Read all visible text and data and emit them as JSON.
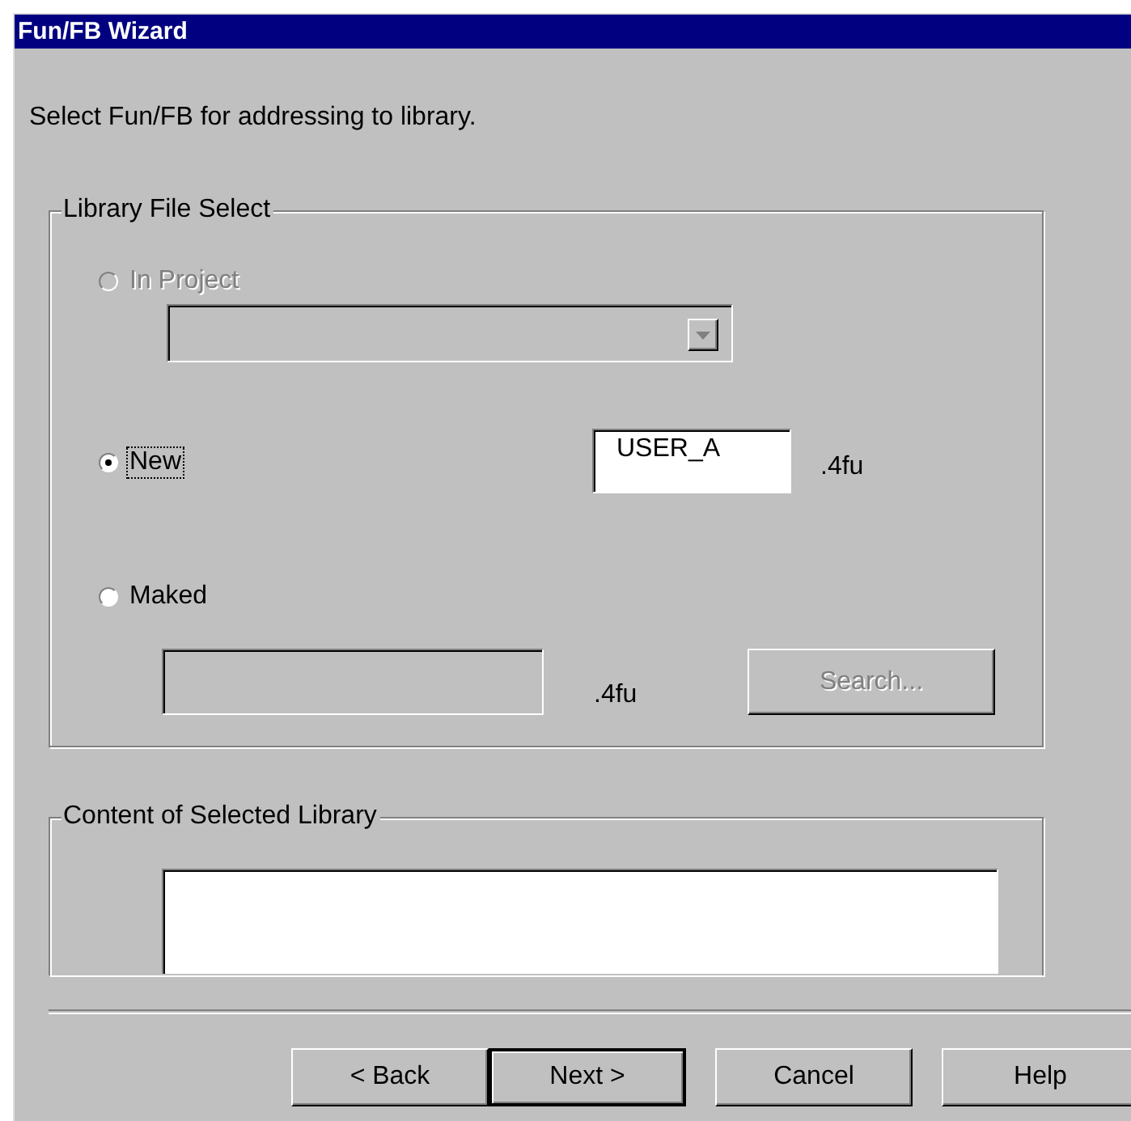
{
  "window": {
    "title": "Fun/FB Wizard"
  },
  "instruction": "Select Fun/FB for addressing to library.",
  "library_file_select": {
    "label": "Library File Select",
    "options": [
      {
        "label": "In Project",
        "selected": false,
        "disabled": true,
        "focused": false
      },
      {
        "label": "New",
        "selected": true,
        "disabled": false,
        "focused": true
      },
      {
        "label": "Maked",
        "selected": false,
        "disabled": false,
        "focused": false
      }
    ],
    "in_project_dropdown": {
      "disabled": true
    },
    "new_name": {
      "value": "USER_A",
      "suffix": ".4fu",
      "disabled": false
    },
    "maked_file": {
      "suffix": ".4fu",
      "disabled": true
    },
    "search_button": {
      "label": "Search...",
      "disabled": true
    }
  },
  "content_of_selected_library": {
    "label": "Content of Selected Library"
  },
  "buttons": [
    {
      "label": "< Back",
      "default": false
    },
    {
      "label": "Next >",
      "default": true
    },
    {
      "label": "Cancel",
      "default": false
    },
    {
      "label": "Help",
      "default": false
    }
  ]
}
